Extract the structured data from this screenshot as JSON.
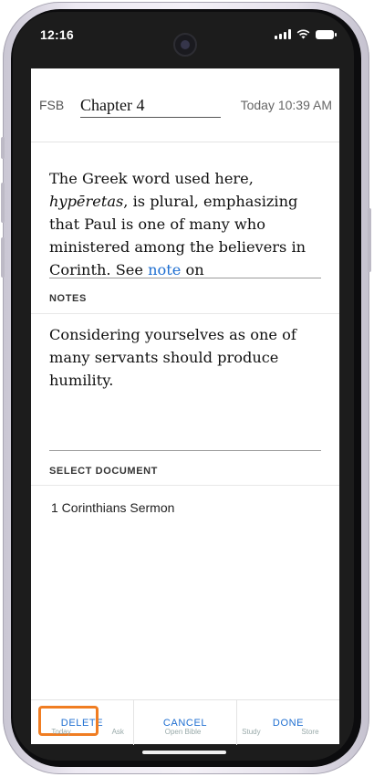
{
  "status_bar": {
    "time": "12:16"
  },
  "header": {
    "version": "FSB",
    "title": "Chapter 4",
    "timestamp": "Today 10:39 AM"
  },
  "passage": {
    "part1": "The Greek word used here, ",
    "term": "hypēretas",
    "part2": ", is plural, emphasizing that Paul is one of many who ministered among the believers in Corinth. See ",
    "link": "note",
    "part3": " on"
  },
  "notes": {
    "label": "NOTES",
    "text": "Considering yourselves as one of many servants should produce humility."
  },
  "select_document": {
    "label": "SELECT DOCUMENT",
    "value": "1 Corinthians Sermon"
  },
  "footer": {
    "delete_label": "DELETE",
    "cancel_label": "CANCEL",
    "done_label": "DONE"
  },
  "tabbar_ghost": [
    "Today",
    "Ask",
    "Open Bible",
    "Study",
    "Store"
  ],
  "colors": {
    "accent": "#1f6fd1",
    "highlight": "#f07d22"
  }
}
